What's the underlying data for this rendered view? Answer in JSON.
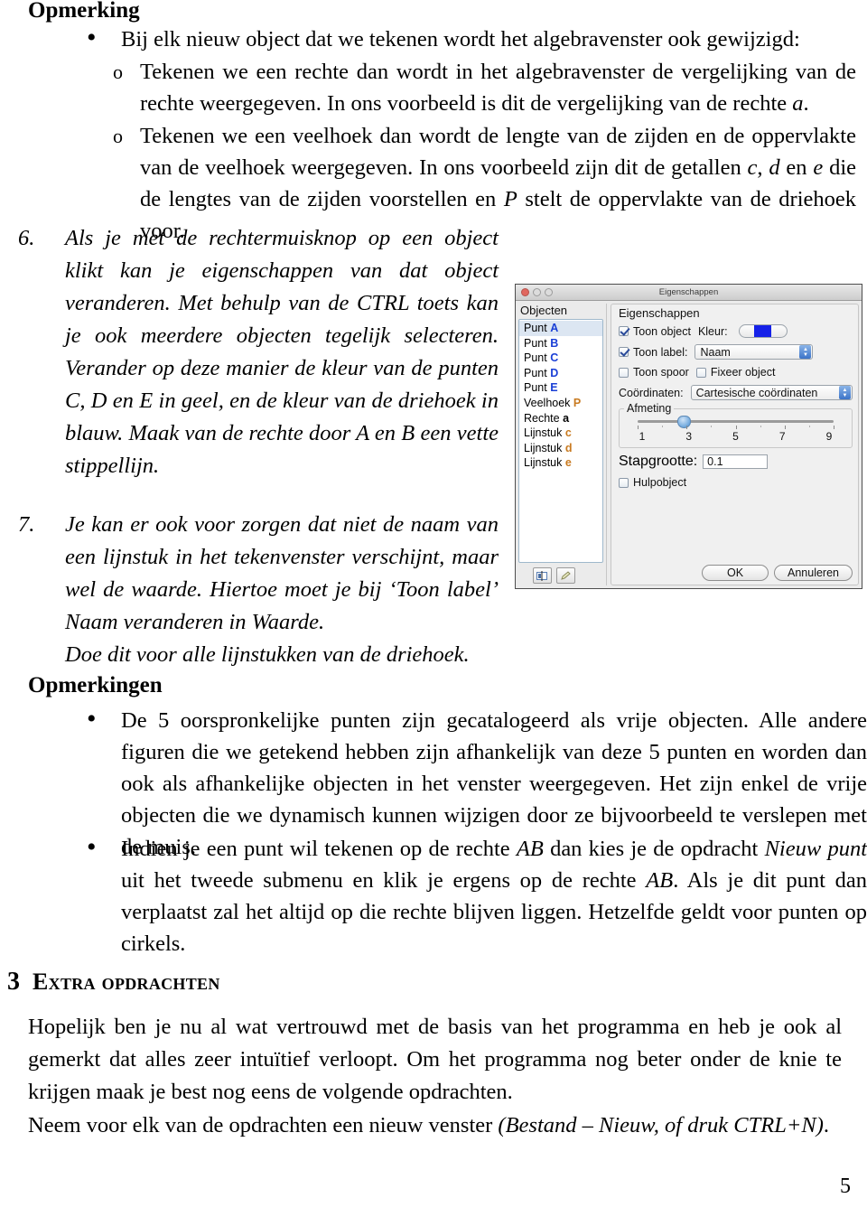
{
  "document": {
    "page_number": "5",
    "opmerking_heading": "Opmerking",
    "opmerkingen_heading": "Opmerkingen",
    "bullets": [
      {
        "marker": "•",
        "text": "Bij elk nieuw object dat we tekenen wordt het algebravenster ook gewijzigd:"
      },
      {
        "marker": "o",
        "text_part1": "Tekenen we een rechte dan wordt in het algebravenster de vergelijking van de rechte weergegeven. In ons voorbeeld is dit de vergelijking van de rechte ",
        "italic1": "a",
        "text_part2": "."
      },
      {
        "marker": "o",
        "text_part1": "Tekenen we een veelhoek dan wordt de lengte van de zijden en de oppervlakte van de veelhoek weergegeven. In ons voorbeeld zijn dit de getallen ",
        "italic_c": "c",
        "sep1": ", ",
        "italic_d": "d",
        "sep2": " en ",
        "italic_e": "e",
        "text_part2": " die de lengtes van de zijden voorstellen en ",
        "italic_P": "P",
        "text_part3": " stelt de oppervlakte van de driehoek voor."
      }
    ],
    "item6": {
      "number": "6.",
      "text": "Als je met de rechtermuisknop op een object klikt kan je eigenschappen van dat object veranderen. Met behulp van de CTRL toets kan je ook meerdere objecten tegelijk selecteren. Verander op deze manier de kleur van de punten C, D en E in geel, en de kleur van de driehoek in blauw. Maak van de rechte door A en B een vette stippellijn."
    },
    "item7": {
      "number": "7.",
      "text": "Je kan er ook voor zorgen dat niet de naam van een lijnstuk in het tekenvenster verschijnt, maar wel de waarde. Hiertoe moet je bij ‘Toon label’ Naam veranderen in Waarde.",
      "text2": "Doe dit voor alle lijnstukken van de driehoek."
    },
    "opmerkingen_bullets": [
      {
        "marker": "•",
        "text": "De 5 oorspronkelijke punten zijn gecatalogeerd als vrije objecten. Alle andere figuren die we getekend hebben zijn afhankelijk van deze 5 punten en worden dan ook als afhankelijke objecten in het venster weergegeven. Het zijn enkel de vrije objecten die we dynamisch kunnen wijzigen door ze bijvoorbeeld te verslepen met de muis."
      },
      {
        "marker": "•",
        "p1": "Indien je een punt wil tekenen op de rechte ",
        "i1": "AB",
        "p2": " dan kies je de opdracht ",
        "i2": "Nieuw punt",
        "p3": " uit het tweede submenu en klik je ergens op de rechte ",
        "i3": "AB",
        "p4": ". Als je dit punt dan verplaatst zal het altijd op die rechte blijven liggen. Hetzelfde geldt voor punten op cirkels."
      }
    ],
    "section3": {
      "number": "3",
      "title": "Extra opdrachten",
      "paragraph": "Hopelijk ben je nu al wat vertrouwd met de basis van het programma en heb je ook al gemerkt dat alles zeer intuïtief verloopt. Om het programma nog beter onder de knie te krijgen maak je best nog eens de volgende opdrachten.",
      "paragraph2_p1": "Neem voor elk van de opdrachten een nieuw venster ",
      "paragraph2_i": "(Bestand – Nieuw, of druk CTRL+N)",
      "paragraph2_p2": "."
    }
  },
  "dialog": {
    "title": "Eigenschappen",
    "objects_title": "Objecten",
    "properties_title": "Eigenschappen",
    "objects": [
      {
        "type": "Punt",
        "name": "A",
        "color_class": "obj-blue",
        "selected": true
      },
      {
        "type": "Punt",
        "name": "B",
        "color_class": "obj-blue",
        "selected": false
      },
      {
        "type": "Punt",
        "name": "C",
        "color_class": "obj-blue",
        "selected": false
      },
      {
        "type": "Punt",
        "name": "D",
        "color_class": "obj-blue",
        "selected": false
      },
      {
        "type": "Punt",
        "name": "E",
        "color_class": "obj-blue",
        "selected": false
      },
      {
        "type": "Veelhoek",
        "name": "P",
        "color_class": "obj-orange",
        "selected": false
      },
      {
        "type": "Rechte",
        "name": "a",
        "color_class": "obj-black",
        "selected": false
      },
      {
        "type": "Lijnstuk",
        "name": "c",
        "color_class": "obj-orange",
        "selected": false
      },
      {
        "type": "Lijnstuk",
        "name": "d",
        "color_class": "obj-orange",
        "selected": false
      },
      {
        "type": "Lijnstuk",
        "name": "e",
        "color_class": "obj-orange",
        "selected": false
      }
    ],
    "toon_object_label": "Toon object",
    "toon_object_checked": true,
    "kleur_label": "Kleur:",
    "kleur_value": "#1521e8",
    "toon_label_label": "Toon label:",
    "toon_label_checked": true,
    "toon_label_value": "Naam",
    "toon_spoor_label": "Toon spoor",
    "toon_spoor_checked": false,
    "fixeer_object_label": "Fixeer object",
    "fixeer_object_checked": false,
    "coordinaten_label": "Coördinaten:",
    "coordinaten_value": "Cartesische coördinaten",
    "afmeting_legend": "Afmeting",
    "afmeting_value": 3,
    "afmeting_ticks": [
      "1",
      "3",
      "5",
      "7",
      "9"
    ],
    "stapgrootte_label": "Stapgrootte:",
    "stapgrootte_value": "0.1",
    "hulpobject_label": "Hulpobject",
    "hulpobject_checked": false,
    "ok_label": "OK",
    "cancel_label": "Annuleren"
  }
}
